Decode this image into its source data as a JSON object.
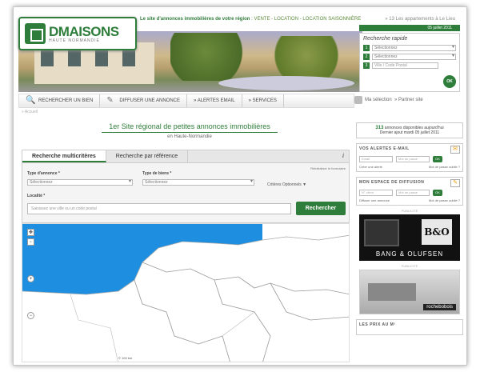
{
  "header": {
    "logo_name": "DMAISONS",
    "logo_sub": "HAUTE NORMANDIE",
    "tagline_bold": "Le site d'annonces immobilières de votre région",
    "tagline_rest": " : VENTE - LOCATION - LOCATION SAISONNIÈRE",
    "toplink": "» 13 Les appartements à Le Lieu",
    "date": "05 juillet 2011"
  },
  "quick_search": {
    "title": "Recherche rapide",
    "rows": [
      {
        "num": "1",
        "value": "Sélectionnez"
      },
      {
        "num": "2",
        "value": "Sélectionnez"
      },
      {
        "num": "3",
        "placeholder": "Ville / Code Postal"
      }
    ],
    "ok": "OK"
  },
  "nav": {
    "items": [
      {
        "label": "RECHERCHER UN BIEN",
        "icon": "🔍"
      },
      {
        "label": "DIFFUSER UNE ANNONCE",
        "icon": "✎"
      },
      {
        "label": "» ALERTES EMAIL",
        "icon": ""
      },
      {
        "label": "» SERVICES",
        "icon": ""
      }
    ],
    "selection": "Ma sélection",
    "partner": "» Partner site"
  },
  "breadcrumb": "» Accueil",
  "headline": {
    "prefix": "1er ",
    "main": "Site régional de petites annonces immobilières",
    "sub": "en Haute-Normandie"
  },
  "search": {
    "tabs": [
      "Recherche multicritères",
      "Recherche par référence"
    ],
    "reset": "Réinitialiser le formulaire",
    "type_annonce_label": "Type d'annonce *",
    "type_annonce_value": "Sélectionnez",
    "type_bien_label": "Type de biens *",
    "type_bien_value": "Sélectionnez",
    "options": "Critères Optionnels ▼",
    "localite_label": "Localité *",
    "localite_placeholder": "Saisissez une ville ou un code postal",
    "button": "Rechercher"
  },
  "map": {
    "scale": "© 100 km"
  },
  "sidebar": {
    "count_line1": "annonces disponibles aujourd'hui",
    "count_num": "313",
    "count_line2": "Dernier ajout mardi 05 juillet 2011",
    "alerts": {
      "title": "VOS ALERTES E-MAIL",
      "email_placeholder": "Email",
      "pass_placeholder": "Mot de passe",
      "ok": "OK",
      "link1": "Créer une alerte",
      "link2": "Mot de passe oublié ?"
    },
    "diffusion": {
      "title": "MON ESPACE DE DIFFUSION",
      "id_placeholder": "N° client",
      "pass_placeholder": "Mot de passe",
      "ok": "OK",
      "link1": "Diffuser une annonce",
      "link2": "Mot de passe oublié ?"
    },
    "pub_label": "PUBLICITÉ",
    "ad1_text": "BANG & OLUFSEN",
    "ad1_logo": "B&O",
    "ad2_brand": "rochebobois",
    "prix_title": "LES PRIX AU M²"
  },
  "colors": {
    "brand_green": "#2e7d3a",
    "sea_blue": "#1e8fe0"
  }
}
